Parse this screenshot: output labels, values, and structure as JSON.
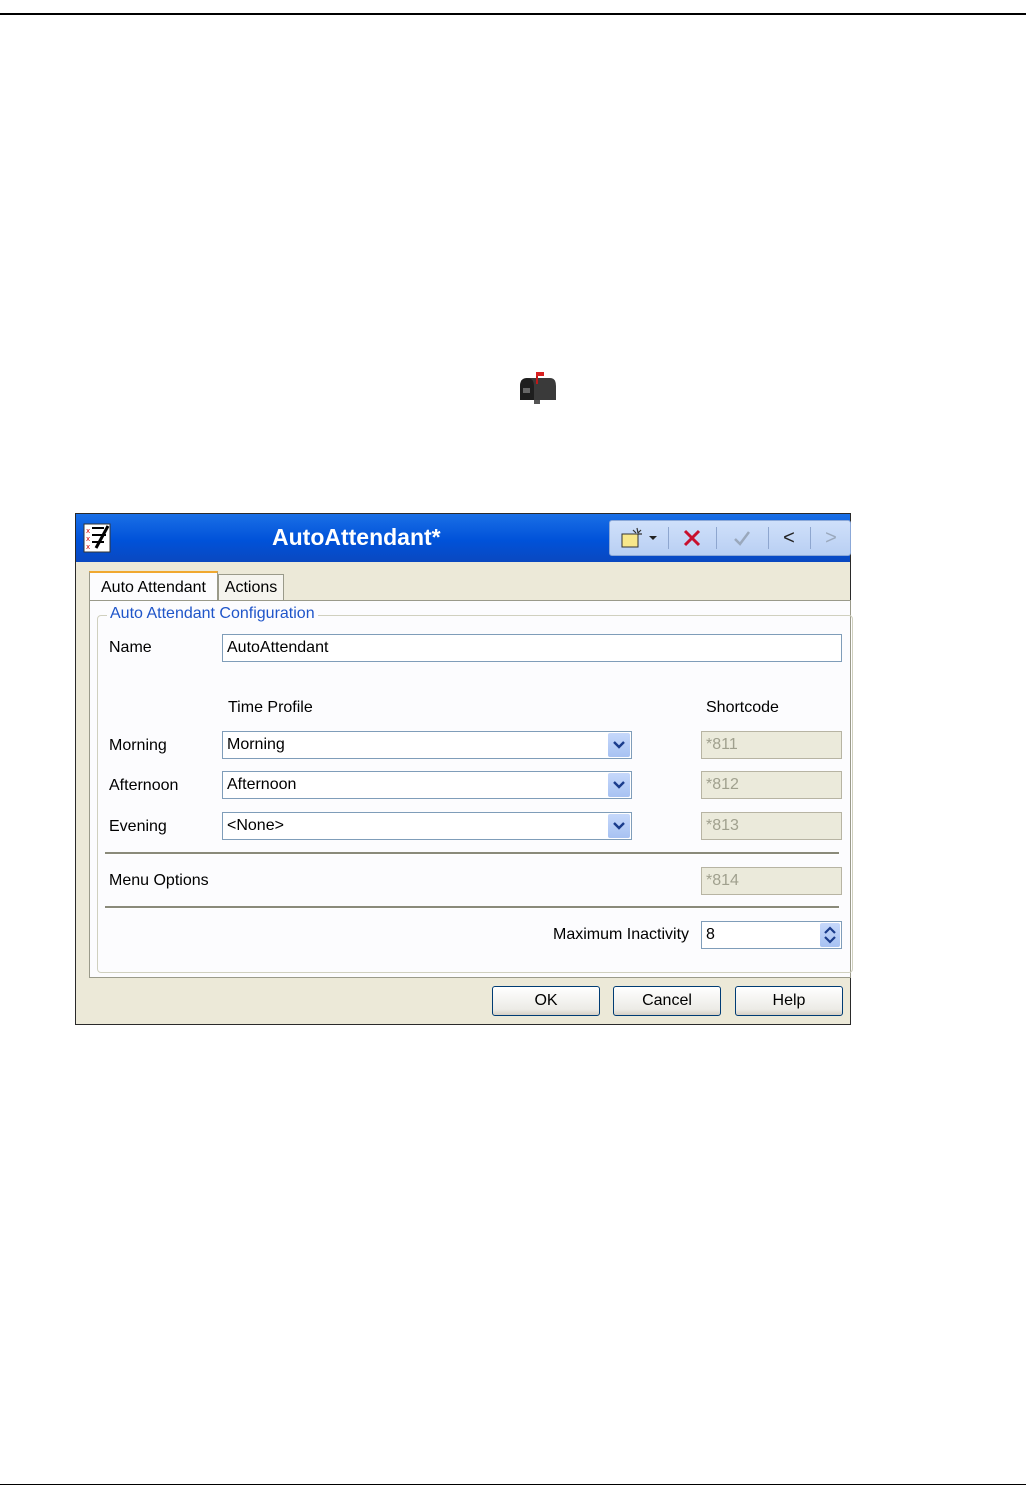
{
  "window": {
    "title": "AutoAttendant*"
  },
  "toolbar": {
    "new_icon": "new-record-icon",
    "dropdown_icon": "chevron-down-icon",
    "delete_icon": "delete-x-icon",
    "validate_icon": "checkmark-icon",
    "prev_label": "<",
    "next_label": ">"
  },
  "tabs": [
    {
      "label": "Auto Attendant",
      "active": true
    },
    {
      "label": "Actions",
      "active": false
    }
  ],
  "group": {
    "title": "Auto Attendant Configuration"
  },
  "name_field": {
    "label": "Name",
    "value": "AutoAttendant"
  },
  "columns": {
    "time_profile": "Time Profile",
    "shortcode": "Shortcode"
  },
  "rows": [
    {
      "label": "Morning",
      "profile": "Morning",
      "shortcode": "*811"
    },
    {
      "label": "Afternoon",
      "profile": "Afternoon",
      "shortcode": "*812"
    },
    {
      "label": "Evening",
      "profile": "<None>",
      "shortcode": "*813"
    }
  ],
  "menu_options": {
    "label": "Menu Options",
    "shortcode": "*814"
  },
  "max_inactivity": {
    "label": "Maximum Inactivity",
    "value": "8"
  },
  "buttons": {
    "ok": "OK",
    "cancel": "Cancel",
    "help": "Help"
  },
  "colors": {
    "titlebar": "#0052d9",
    "group_title": "#1f55c9",
    "tab_accent": "#f0a830",
    "delete": "#c8102e"
  }
}
